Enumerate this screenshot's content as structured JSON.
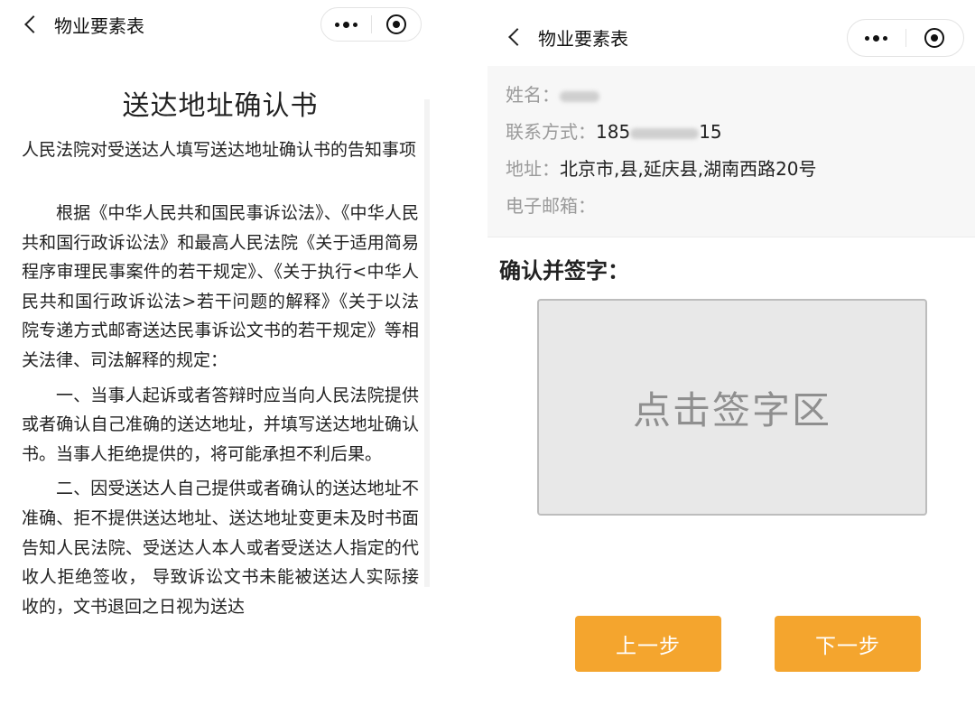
{
  "left": {
    "nav": {
      "title": "物业要素表"
    },
    "document": {
      "title": "送达地址确认书",
      "subtitle": "人民法院对受送达人填写送达地址确认书的告知事项",
      "paragraphs": [
        "根据《中华人民共和国民事诉讼法》、《中华人民共和国行政诉讼法》和最高人民法院《关于适用简易程序审理民事案件的若干规定》、《关于执行<中华人民共和国行政诉讼法>若干问题的解释》《关于以法院专递方式邮寄送达民事诉讼文书的若干规定》等相关法律、司法解释的规定：",
        "一、当事人起诉或者答辩时应当向人民法院提供或者确认自己准确的送达地址，并填写送达地址确认书。当事人拒绝提供的，将可能承担不利后果。",
        "二、因受送达人自己提供或者确认的送达地址不准确、拒不提供送达地址、送达地址变更未及时书面告知人民法院、受送达人本人或者受送达人指定的代收人拒绝签收， 导致诉讼文书未能被送达人实际接收的，文书退回之日视为送达"
      ]
    }
  },
  "right": {
    "nav": {
      "title": "物业要素表"
    },
    "info": {
      "name_label": "姓名：",
      "phone_label": "联系方式：",
      "phone_prefix": "185",
      "phone_suffix": "15",
      "address_label": "地址：",
      "address_value": "北京市,县,延庆县,湖南西路20号",
      "email_label": "电子邮箱："
    },
    "sign": {
      "label": "确认并签字：",
      "placeholder": "点击签字区"
    },
    "buttons": {
      "prev": "上一步",
      "next": "下一步"
    }
  },
  "colors": {
    "button": "#f4a52e",
    "sign_area": "#e8e8e8",
    "info_bg": "#f7f7f7"
  }
}
